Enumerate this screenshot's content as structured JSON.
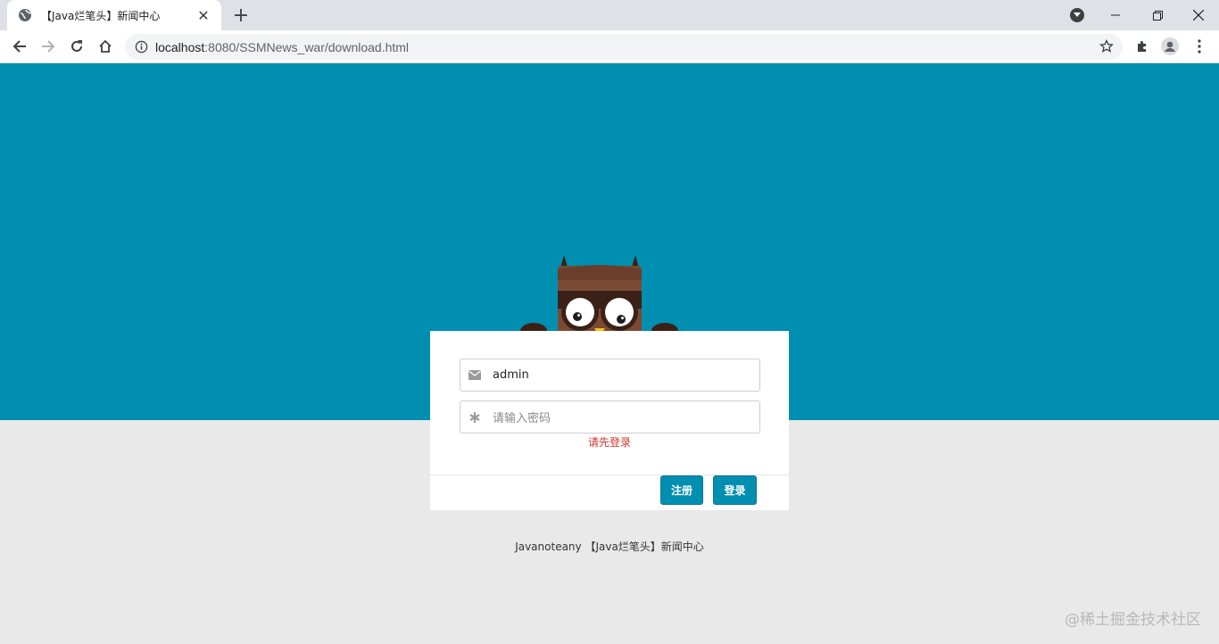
{
  "browser": {
    "tab_title": "【Java烂笔头】新闻中心",
    "url_host": "localhost",
    "url_path": ":8080/SSMNews_war/download.html"
  },
  "login": {
    "username_value": "admin",
    "password_placeholder": "请输入密码",
    "error_message": "请先登录",
    "register_label": "注册",
    "login_label": "登录"
  },
  "footer": {
    "text": "Javanoteany 【Java烂笔头】新闻中心"
  },
  "watermark": "@稀土掘金技术社区",
  "colors": {
    "accent": "#008eb1",
    "background": "#e9e9e9",
    "error": "#d0342c"
  }
}
